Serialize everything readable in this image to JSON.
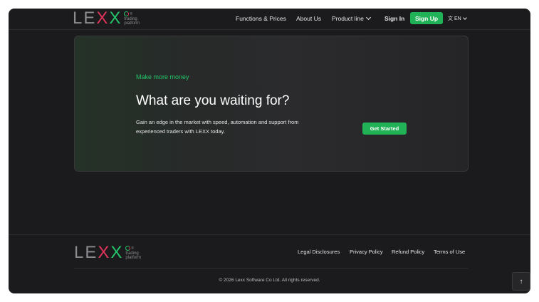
{
  "header": {
    "logo": {
      "letters": [
        "L",
        "E",
        "X",
        "X"
      ],
      "tagline_1": "trading",
      "tagline_2": "platform",
      "reg": "®"
    },
    "nav": {
      "functions": "Functions & Prices",
      "about": "About Us",
      "product_line": "Product line"
    },
    "sign_in": "Sign In",
    "sign_up": "Sign Up",
    "language": "EN",
    "globe_icon": "文"
  },
  "hero": {
    "eyebrow": "Make more money",
    "headline": "What are you waiting for?",
    "description": "Gain an edge in the market with speed, automation and support from experienced traders with LEXX today.",
    "cta": "Get Started"
  },
  "footer": {
    "logo": {
      "letters": [
        "L",
        "E",
        "X",
        "X"
      ],
      "tagline_1": "trading",
      "tagline_2": "platform",
      "reg": "®"
    },
    "links": {
      "legal": "Legal Disclosures",
      "privacy": "Privacy Policy",
      "refund": "Refund Policy",
      "terms": "Terms of Use"
    },
    "copyright": "© 2026 Lexx Software Co Ltd. All rights reserved.",
    "scroll_top_icon": "↑"
  },
  "colors": {
    "accent_green": "#21b257",
    "brand_red": "#e0345a",
    "background": "#1b1b1d"
  }
}
